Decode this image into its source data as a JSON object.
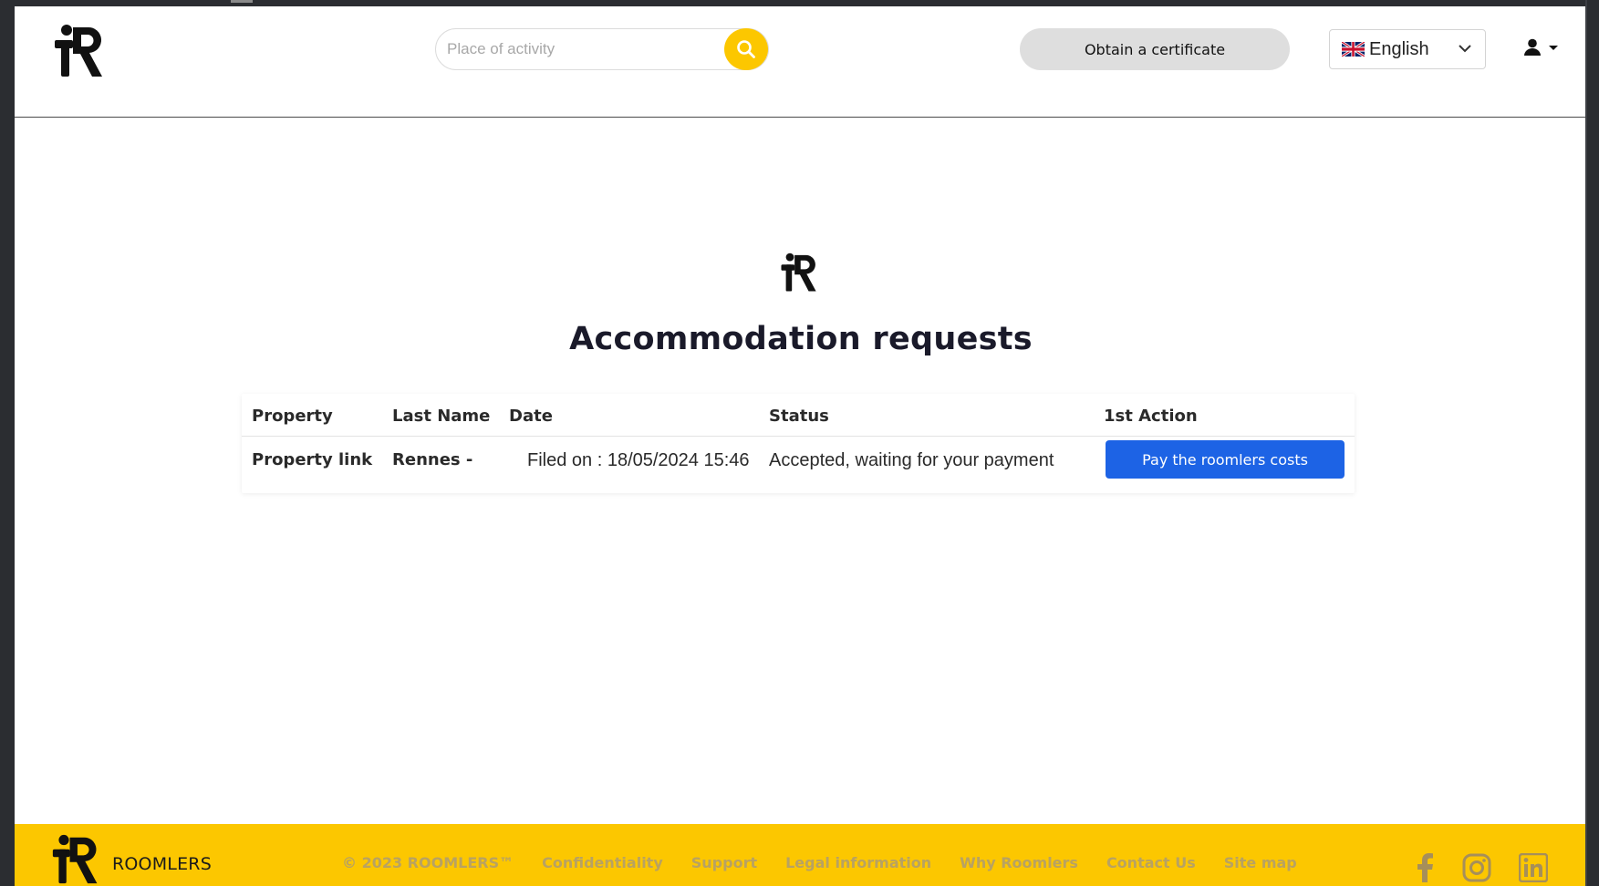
{
  "header": {
    "search_placeholder": "Place of activity",
    "certificate_label": "Obtain a certificate",
    "language_label": "English"
  },
  "main": {
    "title": "Accommodation requests",
    "columns": [
      "Property",
      "Last Name",
      "Date",
      "Status",
      "1st Action"
    ],
    "rows": [
      {
        "property": "Property link",
        "last_name": "Rennes -",
        "date": "Filed on : 18/05/2024 15:46",
        "status": "Accepted, waiting for your payment",
        "action": "Pay the roomlers costs"
      }
    ]
  },
  "footer": {
    "brand": "ROOMLERS",
    "links": [
      "© 2023 ROOMLERS™",
      "Confidentiality",
      "Support",
      "Legal information",
      "Why Roomlers",
      "Contact Us",
      "Site map"
    ]
  },
  "colors": {
    "accent_yellow": "#fcc700",
    "primary_blue": "#1d63e5",
    "muted_footer_text": "#b8a262"
  }
}
